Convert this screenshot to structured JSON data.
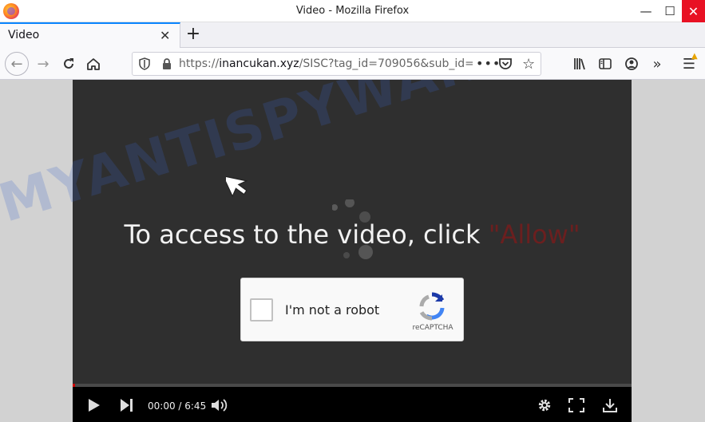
{
  "window": {
    "title": "Video - Mozilla Firefox"
  },
  "tabs": [
    {
      "label": "Video"
    }
  ],
  "url": {
    "scheme": "https://",
    "host": "inancukan.xyz",
    "path": "/SISC?tag_id=709056&sub_id="
  },
  "page": {
    "headline": "To access to the video, click ",
    "headline_allow": "\"Allow\"",
    "captcha_label": "I'm not a robot",
    "captcha_brand": "reCAPTCHA"
  },
  "player": {
    "time": "00:00 / 6:45",
    "progress": 0.0
  },
  "watermark": "MYANTISPYWARE.COM",
  "colors": {
    "accent": "#0a84ff",
    "close": "#e81123",
    "allow": "#6b1f1f"
  }
}
